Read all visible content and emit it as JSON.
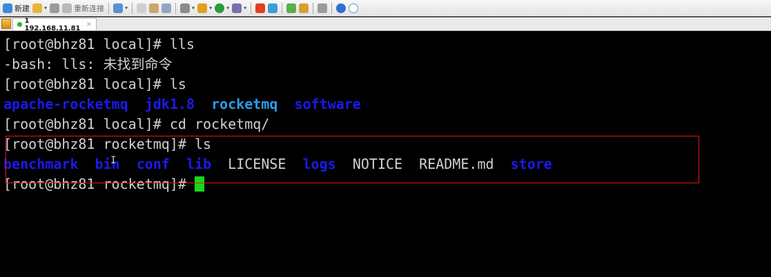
{
  "toolbar": {
    "new_label": "新建",
    "reconnect_label": "重新连接"
  },
  "tab": {
    "label": "1 192.168.11.81",
    "close": "×"
  },
  "terminal": {
    "lines": [
      "[root@bhz81 local]# lls",
      "-bash: lls: 未找到命令",
      "[root@bhz81 local]# ls",
      "",
      "[root@bhz81 local]# cd rocketmq/",
      "[root@bhz81 rocketmq]# ls",
      "",
      "[root@bhz81 rocketmq]# "
    ],
    "ls_local": [
      {
        "text": "apache-rocketmq",
        "color": "blue"
      },
      {
        "text": "jdk1.8",
        "color": "blue"
      },
      {
        "text": "rocketmq",
        "color": "cyan"
      },
      {
        "text": "software",
        "color": "blue"
      }
    ],
    "ls_rocketmq": [
      {
        "text": "benchmark",
        "color": "blue"
      },
      {
        "text": "bin",
        "color": "blue"
      },
      {
        "text": "conf",
        "color": "blue"
      },
      {
        "text": "lib",
        "color": "blue"
      },
      {
        "text": "LICENSE",
        "color": "plain"
      },
      {
        "text": "logs",
        "color": "blue"
      },
      {
        "text": "NOTICE",
        "color": "plain"
      },
      {
        "text": "README.md",
        "color": "plain"
      },
      {
        "text": "store",
        "color": "blue"
      }
    ],
    "colors": {
      "blue": "#1a1aee",
      "cyan": "#2a9ce8",
      "plain": "#d0d0d0",
      "cursor": "#19d619",
      "highlight": "#e01818"
    }
  }
}
